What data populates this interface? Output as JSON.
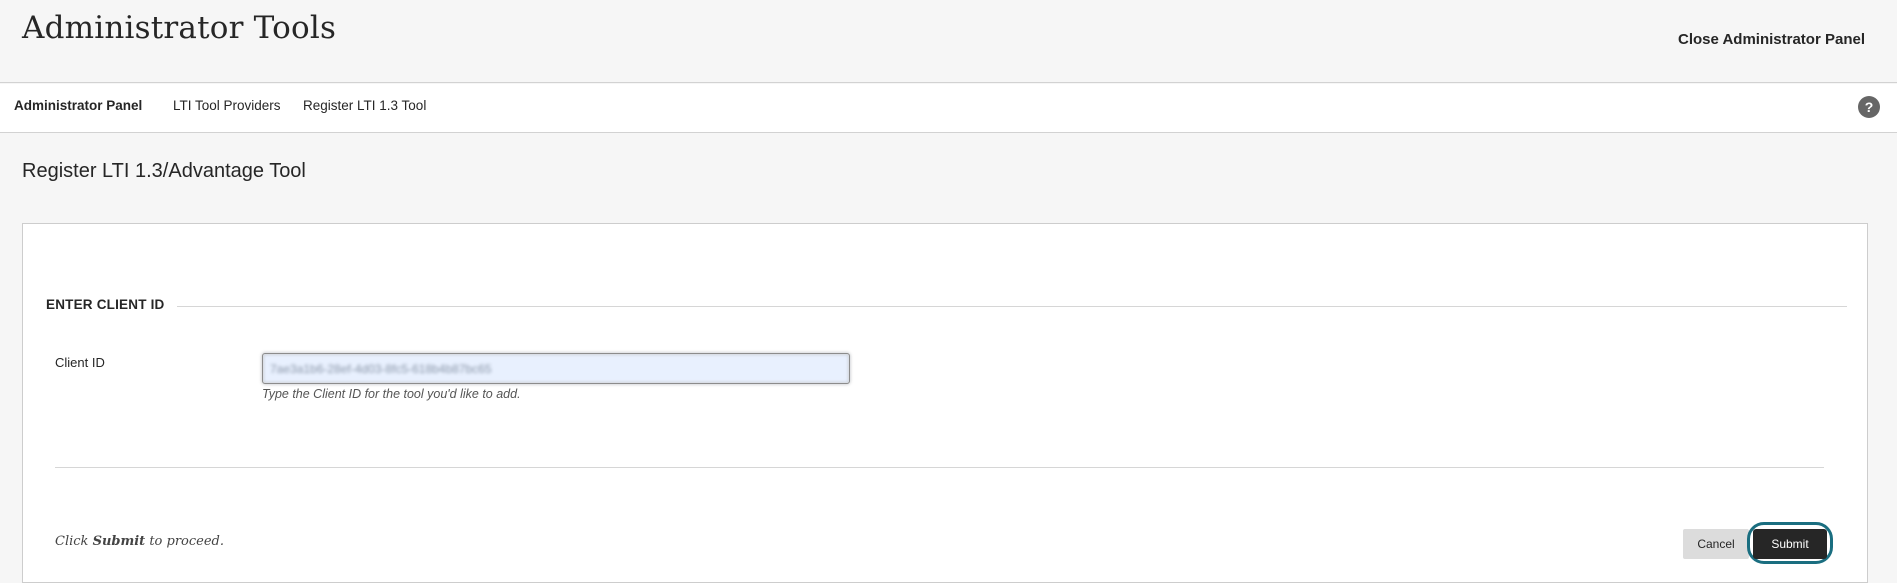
{
  "header": {
    "title": "Administrator Tools",
    "close_label": "Close Administrator Panel"
  },
  "breadcrumb": {
    "items": [
      "Administrator Panel",
      "LTI Tool Providers",
      "Register LTI 1.3 Tool"
    ],
    "help_icon": "?"
  },
  "page": {
    "title": "Register LTI 1.3/Advantage Tool"
  },
  "form": {
    "section_label": "ENTER CLIENT ID",
    "client_id_label": "Client ID",
    "client_id_value": "7ae3a1b6-28ef-4d03-8fc5-618b4b87bc65",
    "client_id_hint": "Type the Client ID for the tool you'd like to add.",
    "proceed_prefix": "Click ",
    "proceed_bold": "Submit",
    "proceed_suffix": " to proceed.",
    "cancel_label": "Cancel",
    "submit_label": "Submit"
  },
  "colors": {
    "page_bg": "#f6f6f6",
    "submit_bg": "#262626",
    "focus_ring": "#1a6e80",
    "input_bg": "#e8f0fe"
  }
}
